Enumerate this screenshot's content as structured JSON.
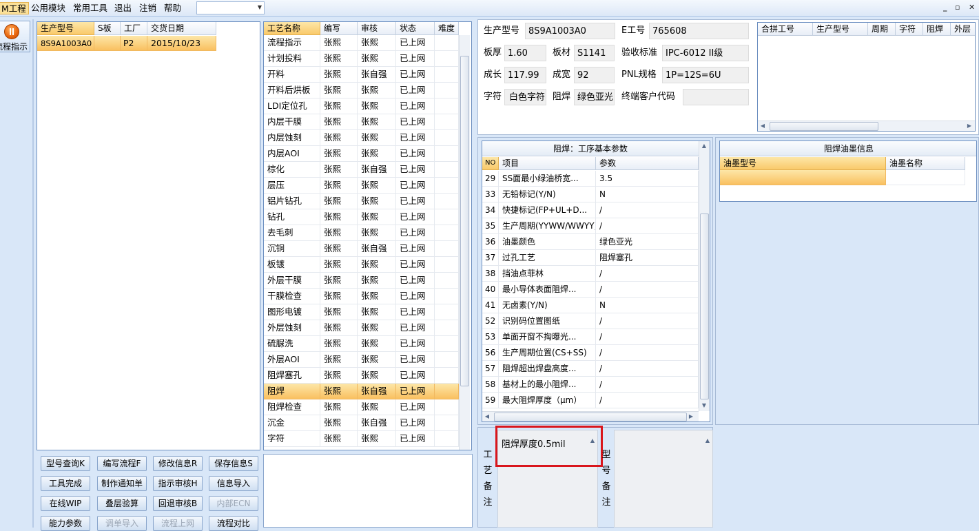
{
  "menubar": {
    "items": [
      {
        "label": "M工程",
        "active": true
      },
      {
        "label": "公用模块"
      },
      {
        "label": "常用工具"
      },
      {
        "label": "退出"
      },
      {
        "label": "注销"
      },
      {
        "label": "帮助"
      }
    ],
    "minimize": "_",
    "restore": "▫",
    "close": "✕"
  },
  "sidebar": {
    "button_label": "流程指示",
    "accent": "#e8640c"
  },
  "orders": {
    "headers": [
      "生产型号",
      "S板",
      "工厂",
      "交货日期"
    ],
    "rows": [
      [
        "8S9A1003A0",
        "",
        "P2",
        "2015/10/23"
      ]
    ]
  },
  "process": {
    "headers": [
      "工艺名称",
      "编写",
      "审核",
      "状态",
      "难度"
    ],
    "rows": [
      [
        "流程指示",
        "张熙",
        "张熙",
        "已上网"
      ],
      [
        "计划投料",
        "张熙",
        "张熙",
        "已上网"
      ],
      [
        "开料",
        "张熙",
        "张自强",
        "已上网"
      ],
      [
        "开料后烘板",
        "张熙",
        "张熙",
        "已上网"
      ],
      [
        "LDI定位孔",
        "张熙",
        "张熙",
        "已上网"
      ],
      [
        "内层干膜",
        "张熙",
        "张熙",
        "已上网"
      ],
      [
        "内层蚀刻",
        "张熙",
        "张熙",
        "已上网"
      ],
      [
        "内层AOI",
        "张熙",
        "张熙",
        "已上网"
      ],
      [
        "棕化",
        "张熙",
        "张自强",
        "已上网"
      ],
      [
        "层压",
        "张熙",
        "张熙",
        "已上网"
      ],
      [
        "铝片钻孔",
        "张熙",
        "张熙",
        "已上网"
      ],
      [
        "钻孔",
        "张熙",
        "张熙",
        "已上网"
      ],
      [
        "去毛刺",
        "张熙",
        "张熙",
        "已上网"
      ],
      [
        "沉铜",
        "张熙",
        "张自强",
        "已上网"
      ],
      [
        "板镀",
        "张熙",
        "张熙",
        "已上网"
      ],
      [
        "外层干膜",
        "张熙",
        "张熙",
        "已上网"
      ],
      [
        "干膜检查",
        "张熙",
        "张熙",
        "已上网"
      ],
      [
        "图形电镀",
        "张熙",
        "张熙",
        "已上网"
      ],
      [
        "外层蚀刻",
        "张熙",
        "张熙",
        "已上网"
      ],
      [
        "硫脲洗",
        "张熙",
        "张熙",
        "已上网"
      ],
      [
        "外层AOI",
        "张熙",
        "张熙",
        "已上网"
      ],
      [
        "阻焊塞孔",
        "张熙",
        "张熙",
        "已上网"
      ],
      [
        "阻焊",
        "张熙",
        "张自强",
        "已上网"
      ],
      [
        "阻焊检查",
        "张熙",
        "张熙",
        "已上网"
      ],
      [
        "沉金",
        "张熙",
        "张自强",
        "已上网"
      ],
      [
        "字符",
        "张熙",
        "张熙",
        "已上网"
      ]
    ],
    "selected_index": 22
  },
  "buttons": [
    "型号查询K",
    "编写流程F",
    "修改信息R",
    "保存信息S",
    "工具完成",
    "制作通知单",
    "指示审核H",
    "信息导入",
    "在线WIP",
    "叠层验算",
    "回退审核B",
    "内部ECN",
    "能力参数",
    "调单导入",
    "流程上网",
    "流程对比"
  ],
  "disabled_buttons": [
    "内部ECN",
    "调单导入",
    "流程上网"
  ],
  "info": {
    "model_label": "生产型号",
    "model": "8S9A1003A0",
    "eno_label": "E工号",
    "eno": "765608",
    "thick_label": "板厚",
    "thick": "1.60",
    "material_label": "板材",
    "material": "S1141",
    "std_label": "验收标准",
    "std": "IPC-6012 II级",
    "len_label": "成长",
    "len": "117.99",
    "wid_label": "成宽",
    "wid": "92",
    "pnl_label": "PNL规格",
    "pnl": "1P=12S=6U",
    "char_label": "字符",
    "char": "白色字符",
    "mask_label": "阻焊",
    "mask": "绿色亚光",
    "cust_label": "终端客户代码",
    "cust": ""
  },
  "merge": {
    "headers": [
      "合拼工号",
      "生产型号",
      "周期",
      "字符",
      "阻焊",
      "外层"
    ]
  },
  "params": {
    "title": "阻焊：工序基本参数",
    "headers": [
      "NO",
      "项目",
      "参数"
    ],
    "rows": [
      [
        "29",
        "SS面最小绿油桥宽...",
        "3.5"
      ],
      [
        "33",
        "无铅标记(Y/N)",
        "N"
      ],
      [
        "34",
        "快捷标记(FP+UL+D...",
        "/"
      ],
      [
        "35",
        "生产周期(YYWW/WWYY)",
        "/"
      ],
      [
        "36",
        "油墨颜色",
        "绿色亚光"
      ],
      [
        "37",
        "过孔工艺",
        "阻焊塞孔"
      ],
      [
        "38",
        "挡油点菲林",
        "/"
      ],
      [
        "40",
        "最小导体表面阻焊...",
        "/"
      ],
      [
        "41",
        "无卤素(Y/N)",
        "N"
      ],
      [
        "52",
        "识别码位置图纸",
        "/"
      ],
      [
        "53",
        "单面开窗不掏曝光...",
        "/"
      ],
      [
        "56",
        "生产周期位置(CS+SS)",
        "/"
      ],
      [
        "57",
        "阻焊超出焊盘高度...",
        "/"
      ],
      [
        "58",
        "基材上的最小阻焊...",
        "/"
      ],
      [
        "59",
        "最大阻焊厚度（μm）",
        "/"
      ]
    ]
  },
  "ink": {
    "title": "阻焊油墨信息",
    "headers": [
      "油墨型号",
      "油墨名称"
    ]
  },
  "remarks": {
    "process_label": "工艺备注",
    "process_text": "阻焊厚度0.5mil",
    "model_label": "型号备注",
    "highlight_color": "#d9161c"
  }
}
